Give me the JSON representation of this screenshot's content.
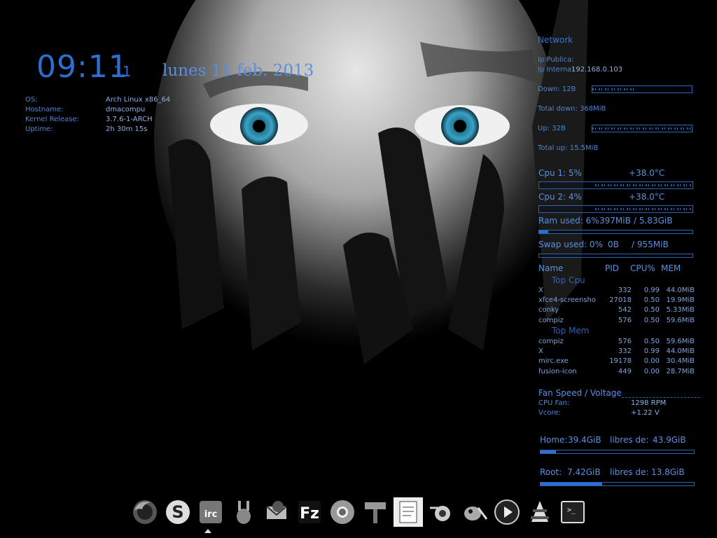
{
  "clock": {
    "time": "09:11",
    "seconds": "11",
    "date": "lunes 11 feb. 2013"
  },
  "system": {
    "rows": [
      {
        "label": "OS:",
        "value": "Arch Linux x86_64"
      },
      {
        "label": "Hostname:",
        "value": "dmacompu"
      },
      {
        "label": "Kernel Release:",
        "value": "3.7.6-1-ARCH"
      },
      {
        "label": "Uptime:",
        "value": "2h 30m 15s"
      }
    ]
  },
  "network": {
    "title": "Network",
    "ip_public": "Ip Publica:",
    "ip_internal_label": "Ip Interna:",
    "ip_internal_value": "192.168.0.103",
    "down": "Down: 12B",
    "total_down": "Total down: 368MiB",
    "up": "Up: 32B",
    "total_up": "Total up: 15.5MiB"
  },
  "cpu": [
    {
      "label": "Cpu 1: 5%",
      "temp": "+38.0°C"
    },
    {
      "label": "Cpu 2: 4%",
      "temp": "+38.0°C"
    }
  ],
  "ram": {
    "label": "Ram used: 6%",
    "used": "397MiB",
    "total": "/ 5.83GiB",
    "fraction": 0.06
  },
  "swap": {
    "label": "Swap used: 0%",
    "used": "0B",
    "total": "/ 955MiB",
    "fraction": 0.0
  },
  "processes": {
    "headers": {
      "name": "Name",
      "pid": "PID",
      "cpu": "CPU%",
      "mem": "MEM"
    },
    "top_cpu_label": "Top Cpu",
    "top_cpu": [
      {
        "name": "X",
        "pid": "332",
        "cpu": "0.99",
        "mem": "44.0MiB"
      },
      {
        "name": "xfce4-screensho",
        "pid": "27018",
        "cpu": "0.50",
        "mem": "19.9MiB"
      },
      {
        "name": "conky",
        "pid": "542",
        "cpu": "0.50",
        "mem": "5.33MiB"
      },
      {
        "name": "compiz",
        "pid": "576",
        "cpu": "0.50",
        "mem": "59.6MiB"
      }
    ],
    "top_mem_label": "Top Mem",
    "top_mem": [
      {
        "name": "compiz",
        "pid": "576",
        "cpu": "0.50",
        "mem": "59.6MiB"
      },
      {
        "name": "X",
        "pid": "332",
        "cpu": "0.99",
        "mem": "44.0MiB"
      },
      {
        "name": "mirc.exe",
        "pid": "19178",
        "cpu": "0.00",
        "mem": "30.4MiB"
      },
      {
        "name": "fusion-icon",
        "pid": "449",
        "cpu": "0.00",
        "mem": "28.7MiB"
      }
    ]
  },
  "sensors": {
    "title": "Fan Speed / Voltage",
    "fan_label": "CPU Fan:",
    "fan_value": "1298 RPM",
    "vcore_label": "Vcore:",
    "vcore_value": "+1.22 V"
  },
  "disks": {
    "home": {
      "label": "Home:",
      "used": "39.4GiB",
      "free_label": "libres de:",
      "total": "43.9GiB",
      "fraction": 0.1
    },
    "root": {
      "label": "Root:",
      "used": "7.42GiB",
      "free_label": "libres de:",
      "total": "13.8GiB",
      "fraction": 0.4
    }
  },
  "dock": {
    "items": [
      {
        "icon": "firefox-icon"
      },
      {
        "icon": "skype-icon",
        "glyph": "S"
      },
      {
        "icon": "mirc-icon",
        "glyph": "irc"
      },
      {
        "icon": "amule-icon"
      },
      {
        "icon": "thunderbird-icon"
      },
      {
        "icon": "filezilla-icon",
        "glyph": "Fz"
      },
      {
        "icon": "chrome-icon"
      },
      {
        "icon": "gparted-icon"
      },
      {
        "icon": "notes-icon"
      },
      {
        "icon": "blender-icon"
      },
      {
        "icon": "gimp-icon"
      },
      {
        "icon": "media-player-icon"
      },
      {
        "icon": "vlc-icon"
      },
      {
        "icon": "terminal-icon",
        "glyph": ">_"
      }
    ]
  }
}
